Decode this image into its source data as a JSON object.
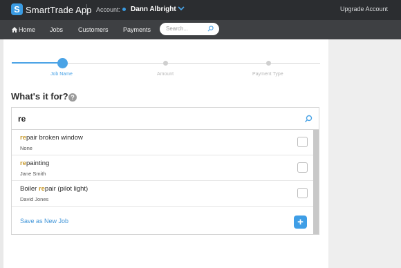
{
  "topbar": {
    "logo_glyph": "S",
    "app_name": "SmartTrade App",
    "account_label": "Account:",
    "account_name": "Dann Albright",
    "upgrade_label": "Upgrade Account"
  },
  "nav": {
    "home_label": "Home",
    "jobs_label": "Jobs",
    "customers_label": "Customers",
    "payments_label": "Payments",
    "search_placeholder": "Search..."
  },
  "steps": [
    {
      "label": "Job Name",
      "state": "active"
    },
    {
      "label": "Amount",
      "state": "inactive"
    },
    {
      "label": "Payment Type",
      "state": "inactive"
    }
  ],
  "form": {
    "question": "What's it for?",
    "help_glyph": "?",
    "search_value": "re"
  },
  "results": [
    {
      "match": "re",
      "rest": "pair broken window",
      "prefix": "",
      "subtitle": "None"
    },
    {
      "match": "re",
      "rest": "painting",
      "prefix": "",
      "subtitle": "Jane Smith"
    },
    {
      "match": "re",
      "rest": "pair (pilot light)",
      "prefix": "Boiler ",
      "subtitle": "David Jones"
    }
  ],
  "save": {
    "label": "Save as New Job",
    "add_glyph": "+"
  },
  "colors": {
    "accent": "#4aa3e6",
    "topbar": "#2b2d30",
    "navbar": "#3e4043",
    "match_highlight": "#c99a2a"
  },
  "icons": {
    "home": "home-icon",
    "search": "search-icon",
    "chevron": "chevron-down-icon",
    "help": "help-icon",
    "add": "plus-icon"
  }
}
